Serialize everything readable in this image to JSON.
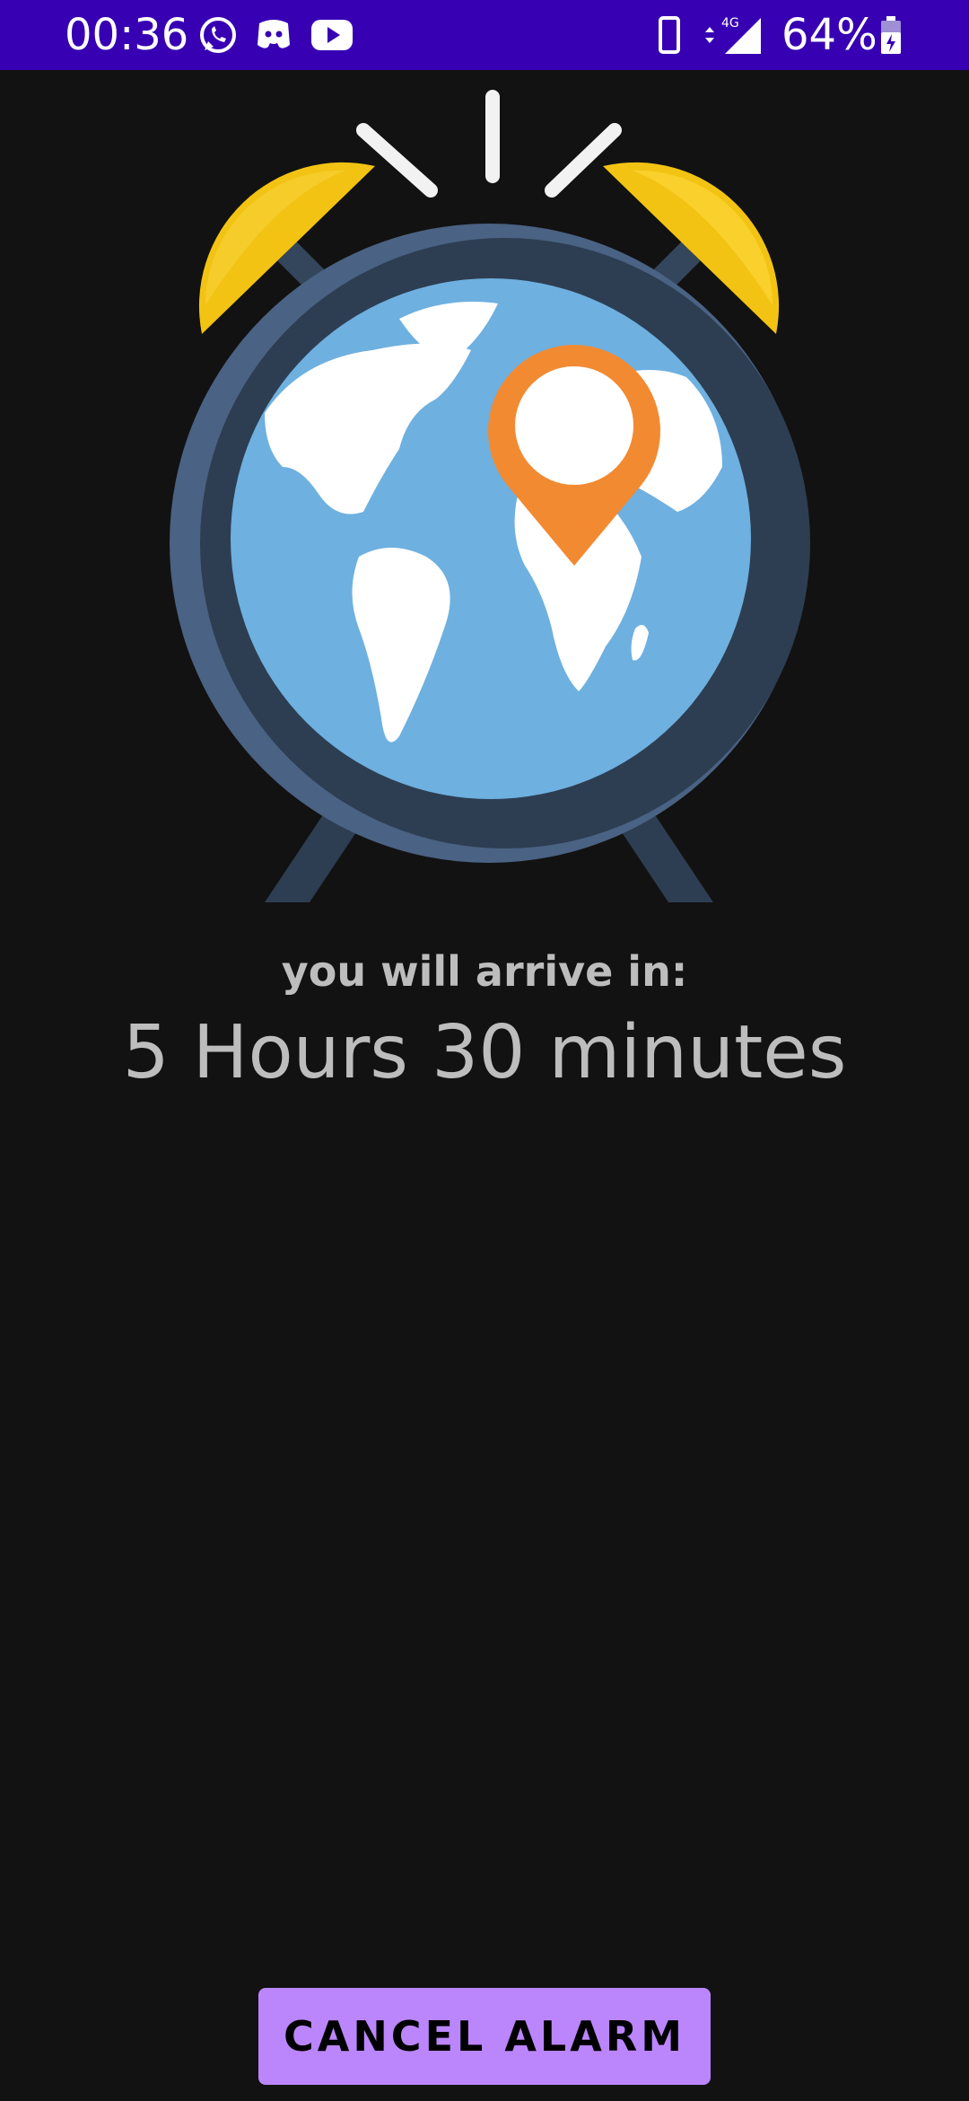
{
  "status_bar": {
    "time": "00:36",
    "battery": "64%",
    "network": "4G",
    "notification_icons": [
      "whatsapp-icon",
      "discord-icon",
      "youtube-icon"
    ],
    "background_color": "#3700b3"
  },
  "illustration": {
    "icon": "alarm-clock-globe-icon",
    "pin_icon": "location-pin-icon"
  },
  "arrival": {
    "label": "you will arrive in:",
    "value": "5 Hours 30 minutes"
  },
  "actions": {
    "cancel_label": "CANCEL ALARM",
    "cancel_color": "#bb86fc"
  },
  "colors": {
    "background": "#121212",
    "text": "#bdbdbd"
  }
}
